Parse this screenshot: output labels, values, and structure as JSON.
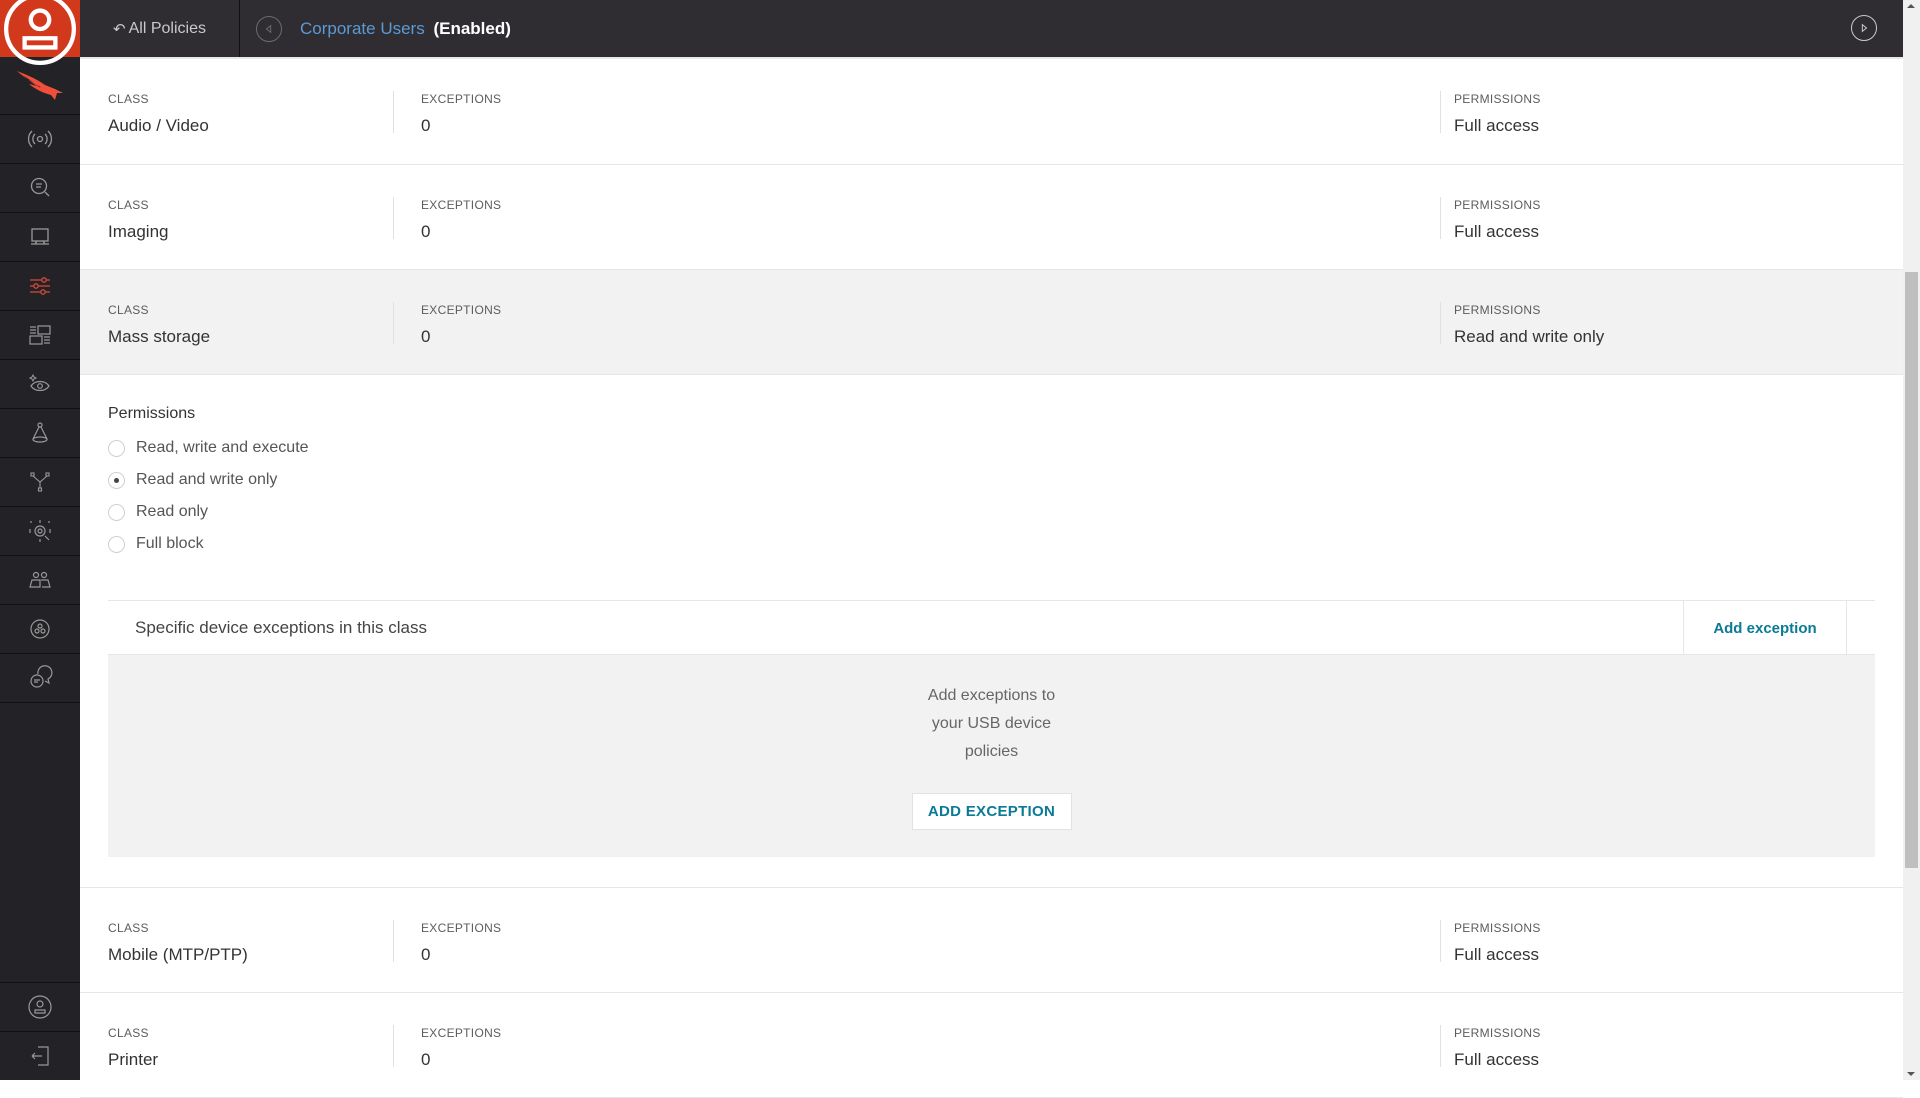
{
  "topbar": {
    "back_label": "All Policies",
    "policy_name": "Corporate Users",
    "policy_state": "(Enabled)"
  },
  "sidebar": {
    "items": [
      {
        "icon": "user-circle-icon"
      },
      {
        "icon": "falcon-logo-icon"
      },
      {
        "icon": "activity-broadcast-icon"
      },
      {
        "icon": "investigate-search-icon"
      },
      {
        "icon": "hosts-monitor-icon"
      },
      {
        "icon": "configuration-sliders-icon",
        "active": true
      },
      {
        "icon": "dashboards-layout-icon"
      },
      {
        "icon": "discover-eye-icon"
      },
      {
        "icon": "spotlight-cone-icon"
      },
      {
        "icon": "connections-network-icon"
      },
      {
        "icon": "intelligence-target-icon"
      },
      {
        "icon": "users-group-icon"
      },
      {
        "icon": "integrations-swirl-icon"
      },
      {
        "icon": "support-chat-icon"
      }
    ],
    "bottom": [
      {
        "icon": "account-icon"
      },
      {
        "icon": "logout-icon"
      }
    ]
  },
  "labels": {
    "class": "CLASS",
    "exceptions": "EXCEPTIONS",
    "permissions": "PERMISSIONS"
  },
  "rows": [
    {
      "class": "Audio / Video",
      "exceptions": "0",
      "permissions": "Full access"
    },
    {
      "class": "Imaging",
      "exceptions": "0",
      "permissions": "Full access"
    },
    {
      "class": "Mass storage",
      "exceptions": "0",
      "permissions": "Read and write only",
      "expanded": true
    },
    {
      "class": "Mobile (MTP/PTP)",
      "exceptions": "0",
      "permissions": "Full access"
    },
    {
      "class": "Printer",
      "exceptions": "0",
      "permissions": "Full access"
    }
  ],
  "expanded": {
    "title": "Permissions",
    "options": [
      {
        "label": "Read, write and execute",
        "selected": false
      },
      {
        "label": "Read and write only",
        "selected": true
      },
      {
        "label": "Read only",
        "selected": false
      },
      {
        "label": "Full block",
        "selected": false
      }
    ],
    "exceptions_header": "Specific device exceptions in this class",
    "add_exception_link": "Add exception",
    "empty_message": "Add exceptions to your USB device policies",
    "add_exception_button": "ADD EXCEPTION"
  },
  "colors": {
    "brand": "#d2381c",
    "link": "#5a9ad6",
    "action": "#0a7a97"
  }
}
